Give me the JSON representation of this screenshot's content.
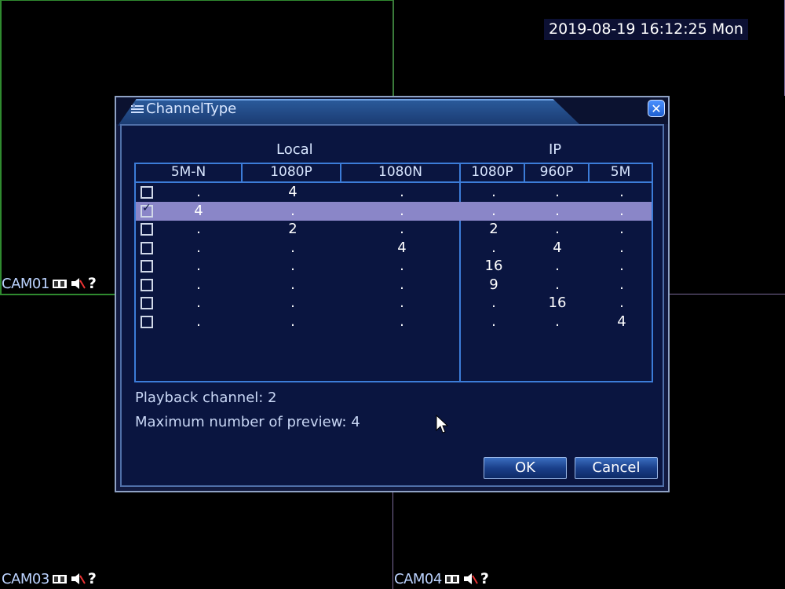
{
  "screen": {
    "datetime": "2019-08-19 16:12:25 Mon",
    "cameras": [
      {
        "label": "CAM01"
      },
      {
        "label": "CAM03"
      },
      {
        "label": "CAM04"
      }
    ],
    "help_glyph": "?"
  },
  "dialog": {
    "title": "ChannelType",
    "close_glyph": "✕",
    "groups": {
      "local": "Local",
      "ip": "IP"
    },
    "columns": [
      "5M-N",
      "1080P",
      "1080N",
      "1080P",
      "960P",
      "5M"
    ],
    "rows": [
      {
        "checked": false,
        "cells": [
          ".",
          "4",
          ".",
          ".",
          ".",
          "."
        ]
      },
      {
        "checked": true,
        "cells": [
          "4",
          ".",
          ".",
          ".",
          ".",
          "."
        ]
      },
      {
        "checked": false,
        "cells": [
          ".",
          "2",
          ".",
          "2",
          ".",
          "."
        ]
      },
      {
        "checked": false,
        "cells": [
          ".",
          ".",
          "4",
          ".",
          "4",
          "."
        ]
      },
      {
        "checked": false,
        "cells": [
          ".",
          ".",
          ".",
          "16",
          ".",
          "."
        ]
      },
      {
        "checked": false,
        "cells": [
          ".",
          ".",
          ".",
          "9",
          ".",
          "."
        ]
      },
      {
        "checked": false,
        "cells": [
          ".",
          ".",
          ".",
          ".",
          "16",
          "."
        ]
      },
      {
        "checked": false,
        "cells": [
          ".",
          ".",
          ".",
          ".",
          ".",
          "4"
        ]
      }
    ],
    "playback_channel": "Playback channel: 2",
    "max_preview": "Maximum number of preview: 4",
    "ok_label": "OK",
    "cancel_label": "Cancel"
  }
}
